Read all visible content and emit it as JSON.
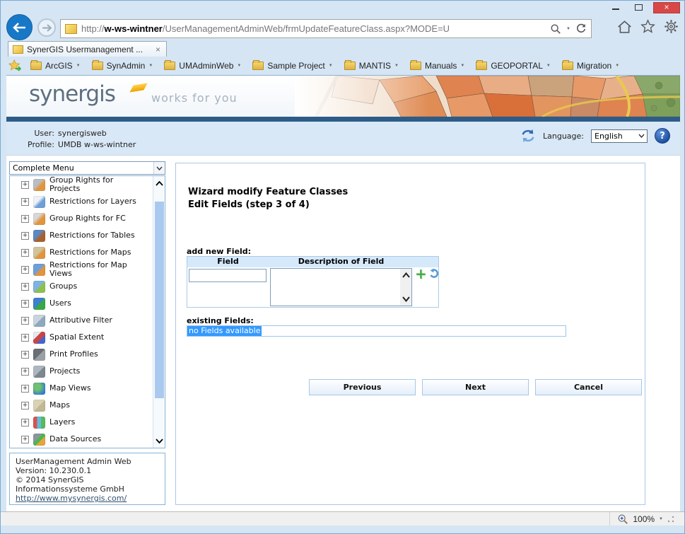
{
  "icons": {
    "close_window": "×",
    "tab_close": "×",
    "caret_down": "▼",
    "plus": "+",
    "help": "?"
  },
  "browser": {
    "url_scheme": "http://",
    "url_host": "w-ws-wintner",
    "url_path": "/UserManagementAdminWeb/frmUpdateFeatureClass.aspx?MODE=U",
    "tab_title": "SynerGIS Usermanagement ...",
    "favorites": [
      "ArcGIS",
      "SynAdmin",
      "UMAdminWeb",
      "Sample Project",
      "MANTIS",
      "Manuals",
      "GEOPORTAL",
      "Migration"
    ],
    "status_zoom": "100%"
  },
  "banner": {
    "logo": "synergis",
    "tagline": "works for you"
  },
  "app_header": {
    "user_label": "User:",
    "user_value": "synergisweb",
    "profile_label": "Profile:",
    "profile_value": "UMDB w-ws-wintner",
    "language_label": "Language:",
    "language_value": "English"
  },
  "sidebar": {
    "menu_filter": "Complete Menu",
    "items": [
      {
        "label": "Group Rights for Projects",
        "icon_style": "background:linear-gradient(135deg,#b9bec4 40%,#e2953e 60%)"
      },
      {
        "label": "Restrictions for Layers",
        "icon_style": "background:linear-gradient(135deg,#eef2f6 40%,#6f9fd8 60%)"
      },
      {
        "label": "Group Rights for FC",
        "icon_style": "background:linear-gradient(135deg,#d8d8d8 35%,#e2953e 60%)"
      },
      {
        "label": "Restrictions for Tables",
        "icon_style": "background:linear-gradient(135deg,#5b87c5 40%,#a8622d 60%)"
      },
      {
        "label": "Restrictions for Maps",
        "icon_style": "background:linear-gradient(135deg,#cfc49e 45%,#e2953e 60%)"
      },
      {
        "label": "Restrictions for Map Views",
        "icon_style": "background:linear-gradient(135deg,#6f9fd8 45%,#e2953e 60%)"
      },
      {
        "label": "Groups",
        "icon_style": "background:linear-gradient(135deg,#7fb2e5 45%,#8cc152 55%)"
      },
      {
        "label": "Users",
        "icon_style": "background:linear-gradient(135deg,#3d7fd0 45%,#39a845 55%)"
      },
      {
        "label": "Attributive Filter",
        "icon_style": "background:linear-gradient(135deg,#c9d4de 50%,#8fa8bf 50%)"
      },
      {
        "label": "Spatial Extent",
        "icon_style": "background:linear-gradient(135deg,#e5e9ee 35%,#cc4444 35%,#cc4444 62%,#4466cc 62%)"
      },
      {
        "label": "Print Profiles",
        "icon_style": "background:linear-gradient(135deg,#6a6f75 50%,#9aa0a6 50%)"
      },
      {
        "label": "Projects",
        "icon_style": "background:linear-gradient(135deg,#aeb6bf 50%,#7d8791 50%)"
      },
      {
        "label": "Map Views",
        "icon_style": "background:radial-gradient(circle at 35% 35%,#6fc06f 30%,#2f7fd0 75%)"
      },
      {
        "label": "Maps",
        "icon_style": "background:linear-gradient(135deg,#d9d2b4 50%,#c2b894 50%)"
      },
      {
        "label": "Layers",
        "icon_style": "background:linear-gradient(90deg,#d9534f 33%,#5bc0de 33%,#5bc0de 66%,#5cb85c 66%)"
      },
      {
        "label": "Data Sources",
        "icon_style": "background:linear-gradient(135deg,#8d959d 40%,#49b84f 40%,#49b84f 60%,#e8a33d 60%)"
      }
    ],
    "about": {
      "line1": "UserManagement Admin Web",
      "line2": "Version: 10.230.0.1",
      "line3": "© 2014 SynerGIS",
      "line4": "Informationssysteme GmbH",
      "link": "http://www.mysynergis.com/"
    }
  },
  "wizard": {
    "title_line1": "Wizard modify Feature Classes",
    "title_line2": "Edit Fields (step 3 of 4)",
    "add_field_label": "add new Field:",
    "col_field": "Field",
    "col_description": "Description of Field",
    "field_input_value": "",
    "description_input_value": "",
    "existing_label": "existing Fields:",
    "existing_value": "no Fields available",
    "btn_previous": "Previous",
    "btn_next": "Next",
    "btn_cancel": "Cancel"
  },
  "colors": {
    "selection_bg": "#3399ff",
    "banner_bar_blue": "#2d5c88",
    "chrome_bg": "#d5e5f4",
    "close_button_red": "#d94747",
    "logo_swoosh_yellow": "#f0a200",
    "header_band_blue": "#d9e8f6",
    "table_header_blue": "#d6e9fb"
  }
}
